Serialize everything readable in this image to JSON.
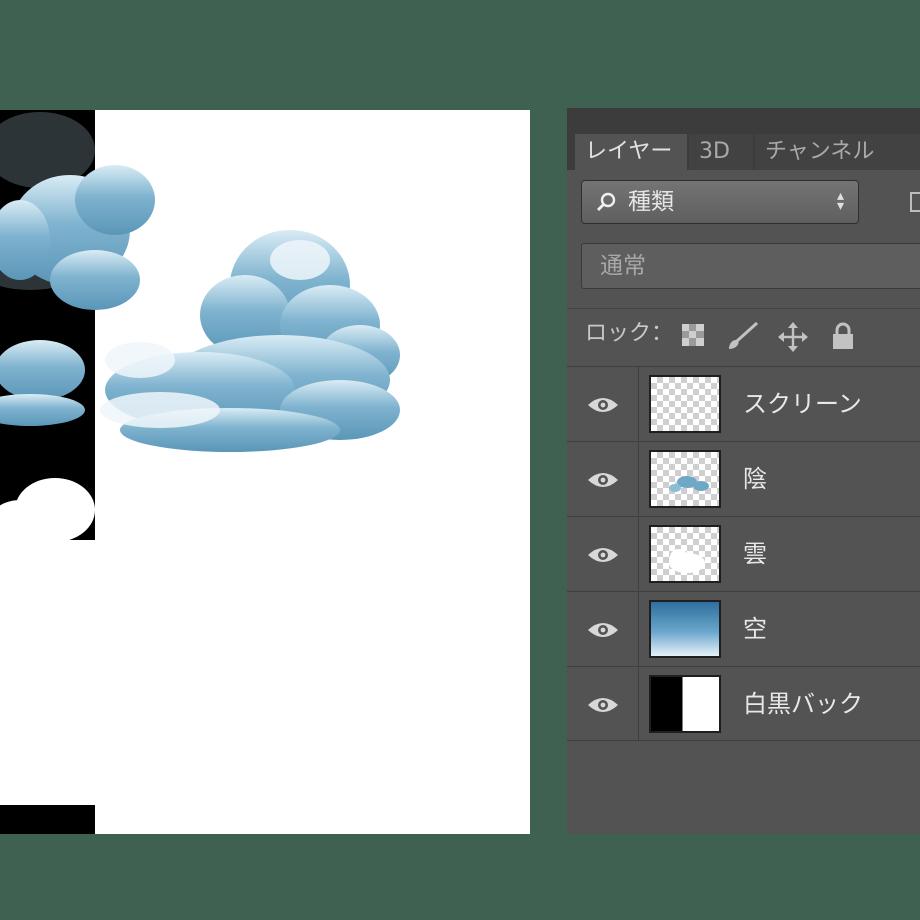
{
  "panel": {
    "tabs": [
      {
        "label": "レイヤー",
        "active": true
      },
      {
        "label": "3D",
        "active": false
      },
      {
        "label": "チャンネル",
        "active": false
      }
    ],
    "filter": {
      "label": "種類",
      "icon": "search-icon"
    },
    "blend_mode": "通常",
    "lock_label": "ロック："
  },
  "layers": [
    {
      "name": "スクリーン",
      "thumbnail": "transparent"
    },
    {
      "name": "陰",
      "thumbnail": "transparent-shadow"
    },
    {
      "name": "雲",
      "thumbnail": "transparent-cloud"
    },
    {
      "name": "空",
      "thumbnail": "sky-gradient"
    },
    {
      "name": "白黒バック",
      "thumbnail": "black-white"
    }
  ],
  "colors": {
    "app_background": "#3f6152",
    "panel": "#535353",
    "cloud_blue": "#6fa8c6"
  }
}
